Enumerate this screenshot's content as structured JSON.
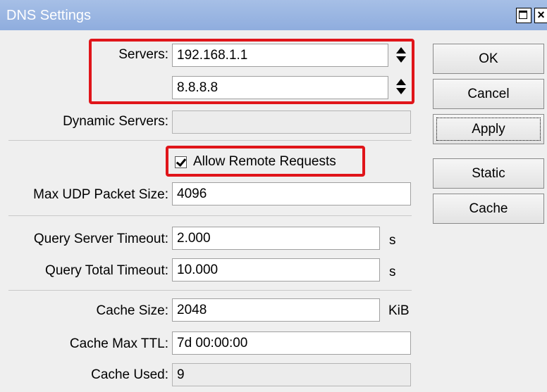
{
  "window": {
    "title": "DNS Settings",
    "maximize_icon": "maximize-icon",
    "close_label": "×"
  },
  "form": {
    "servers_label": "Servers:",
    "server_1": "192.168.1.1",
    "server_2": "8.8.8.8",
    "dynamic_servers_label": "Dynamic Servers:",
    "dynamic_servers_value": "",
    "allow_remote_label": "Allow Remote Requests",
    "allow_remote_checked": true,
    "max_udp_label": "Max UDP Packet Size:",
    "max_udp_value": "4096",
    "query_server_timeout_label": "Query Server Timeout:",
    "query_server_timeout_value": "2.000",
    "query_server_timeout_unit": "s",
    "query_total_timeout_label": "Query Total Timeout:",
    "query_total_timeout_value": "10.000",
    "query_total_timeout_unit": "s",
    "cache_size_label": "Cache Size:",
    "cache_size_value": "2048",
    "cache_size_unit": "KiB",
    "cache_max_ttl_label": "Cache Max TTL:",
    "cache_max_ttl_value": "7d 00:00:00",
    "cache_used_label": "Cache Used:",
    "cache_used_value": "9"
  },
  "buttons": {
    "ok": "OK",
    "cancel": "Cancel",
    "apply": "Apply",
    "static": "Static",
    "cache": "Cache"
  },
  "colors": {
    "titlebar": "#8fadde",
    "highlight": "#e0151a",
    "background": "#efefef"
  }
}
